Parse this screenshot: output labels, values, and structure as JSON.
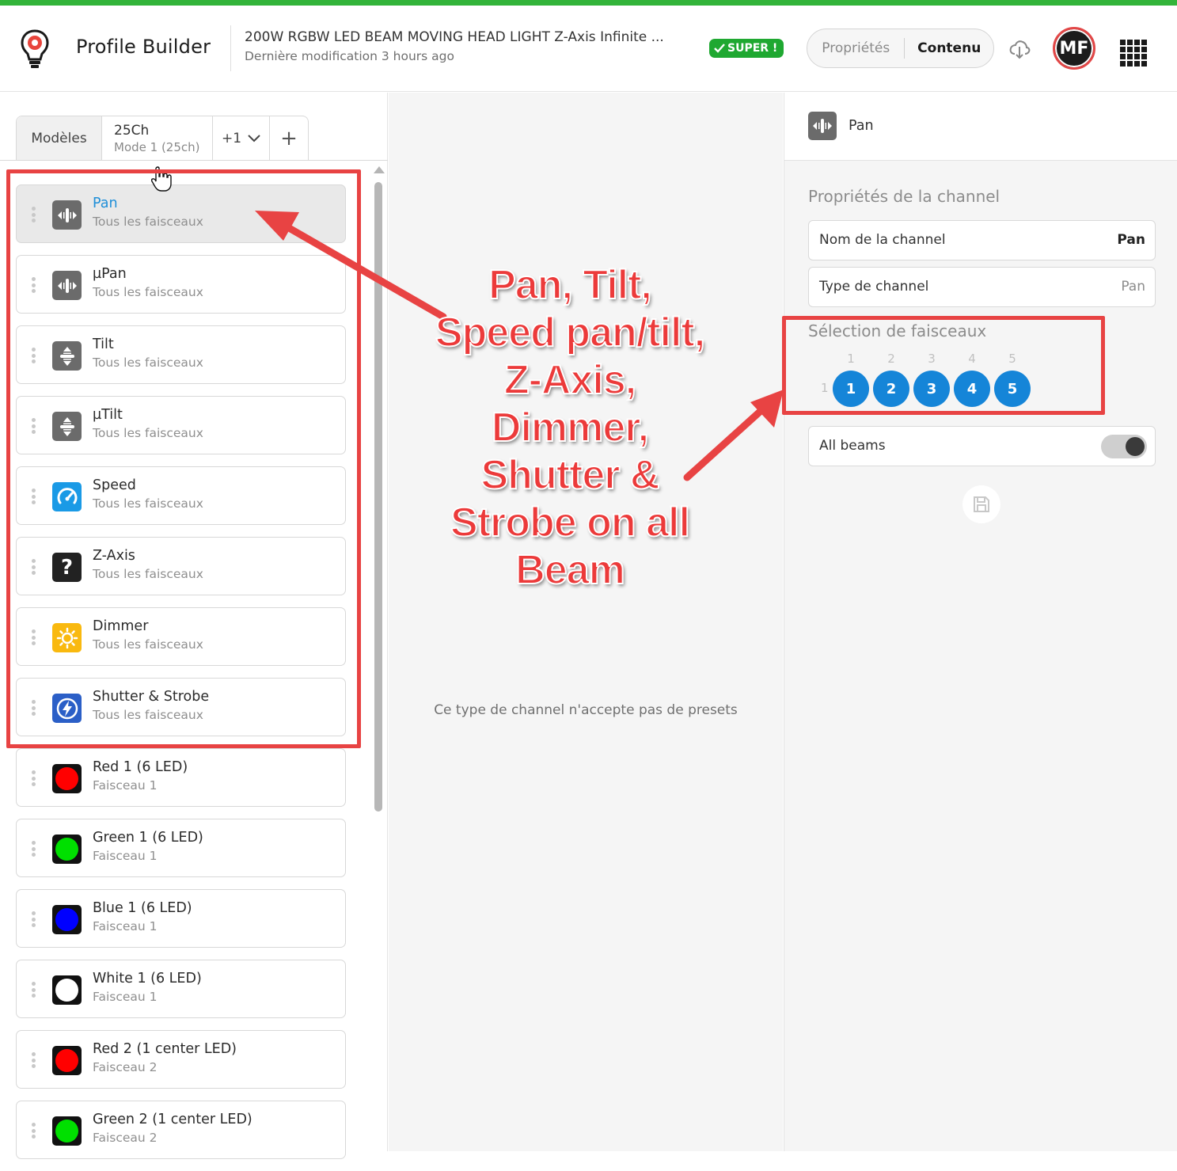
{
  "header": {
    "app_title": "Profile Builder",
    "doc_title": "200W RGBW LED BEAM MOVING HEAD LIGHT Z-Axis Infinite ...",
    "doc_subtitle": "Dernière modification 3 hours ago",
    "badge": "SUPER !",
    "segment": {
      "left": "Propriétés",
      "right": "Contenu"
    },
    "avatar_initials": "MF",
    "accent_color": "#33b43a"
  },
  "tabs": {
    "models": "Modèles",
    "current_title": "25Ch",
    "current_sub": "Mode 1 (25ch)",
    "more": "+1",
    "add": "+"
  },
  "channels": [
    {
      "name": "Pan",
      "sub": "Tous les faisceaux",
      "icon": "pan-icon"
    },
    {
      "name": "µPan",
      "sub": "Tous les faisceaux",
      "icon": "pan-icon"
    },
    {
      "name": "Tilt",
      "sub": "Tous les faisceaux",
      "icon": "tilt-icon"
    },
    {
      "name": "µTilt",
      "sub": "Tous les faisceaux",
      "icon": "tilt-icon"
    },
    {
      "name": "Speed",
      "sub": "Tous les faisceaux",
      "icon": "speed-icon"
    },
    {
      "name": "Z-Axis",
      "sub": "Tous les faisceaux",
      "icon": "question-icon",
      "icon_text": "?"
    },
    {
      "name": "Dimmer",
      "sub": "Tous les faisceaux",
      "icon": "sun-icon"
    },
    {
      "name": "Shutter & Strobe",
      "sub": "Tous les faisceaux",
      "icon": "lightning-icon"
    },
    {
      "name": "Red 1 (6 LED)",
      "sub": "Faisceau 1",
      "color": "#ff0000"
    },
    {
      "name": "Green 1 (6 LED)",
      "sub": "Faisceau 1",
      "color": "#00e000"
    },
    {
      "name": "Blue 1 (6 LED)",
      "sub": "Faisceau 1",
      "color": "#0000ff"
    },
    {
      "name": "White 1 (6 LED)",
      "sub": "Faisceau 1",
      "color": "#ffffff"
    },
    {
      "name": "Red 2 (1 center LED)",
      "sub": "Faisceau 2",
      "color": "#ff0000"
    },
    {
      "name": "Green 2 (1 center LED)",
      "sub": "Faisceau 2",
      "color": "#00e000"
    }
  ],
  "middle": {
    "message": "Ce type de channel n'accepte pas de presets"
  },
  "panel": {
    "header_label": "Pan",
    "props_title": "Propriétés de la channel",
    "name_label": "Nom de la channel",
    "name_value": "Pan",
    "type_label": "Type de channel",
    "type_value": "Pan",
    "beams_title": "Sélection de faisceaux",
    "beam_row_label": "1",
    "beams": [
      "1",
      "2",
      "3",
      "4",
      "5"
    ],
    "beam_color": "#1585d8",
    "all_beams_label": "All beams",
    "all_beams_on": true
  },
  "annotation": {
    "text_lines": [
      "Pan, Tilt,",
      "Speed pan/tilt,",
      "Z-Axis,",
      "Dimmer,",
      "Shutter &",
      "Strobe on all",
      "Beam"
    ],
    "color": "#e84343"
  }
}
